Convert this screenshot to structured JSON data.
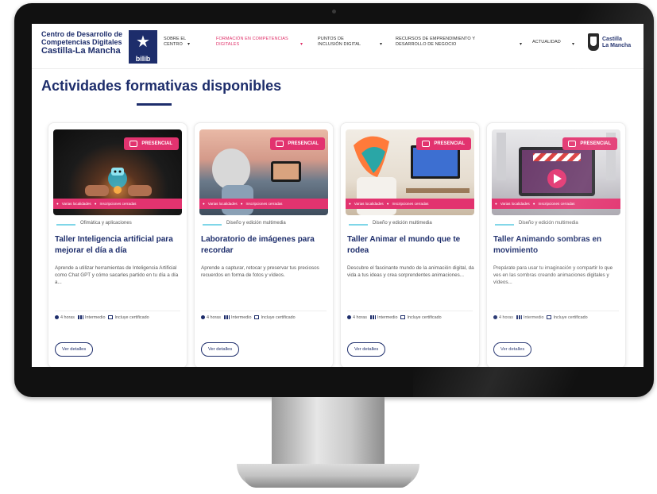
{
  "header": {
    "logo": {
      "line1": "Centro de Desarrollo de",
      "line2": "Competencias Digitales",
      "line3": "Castilla-La Mancha",
      "badge": "bilib"
    },
    "nav": [
      {
        "label": "SOBRE EL CENTRO",
        "active": false
      },
      {
        "label": "FORMACIÓN EN COMPETENCIAS DIGITALES",
        "active": true
      },
      {
        "label": "PUNTOS DE INCLUSIÓN DIGITAL",
        "active": false
      },
      {
        "label": "RECURSOS DE EMPRENDIMIENTO Y DESARROLLO DE NEGOCIO",
        "active": false
      },
      {
        "label": "ACTUALIDAD",
        "active": false
      }
    ],
    "region_logo": {
      "line1": "Castilla",
      "line2": "La Mancha"
    }
  },
  "section_title": "Actividades formativas disponibles",
  "cards": [
    {
      "badge": "PRESENCIAL",
      "locations": "Varias localidades",
      "status": "Inscripciones cerradas",
      "category": "Ofimática y aplicaciones",
      "title": "Taller Inteligencia artificial para mejorar el día a día",
      "description": "Aprende a utilizar herramientas de Inteligencia Artificial como Chat GPT y cómo sacarles partido en tu día a día a...",
      "duration": "4 horas",
      "level": "Intermedio",
      "certificate": "Incluye certificado",
      "button": "Ver detalles"
    },
    {
      "badge": "PRESENCIAL",
      "locations": "Varias localidades",
      "status": "Inscripciones cerradas",
      "category": "Diseño y edición multimedia",
      "title": "Laboratorio de imágenes para recordar",
      "description": "Aprende a capturar, retocar y preservar tus preciosos recuerdos en forma de fotos y vídeos.",
      "duration": "4 horas",
      "level": "Intermedio",
      "certificate": "Incluye certificado",
      "button": "Ver detalles"
    },
    {
      "badge": "PRESENCIAL",
      "locations": "Varias localidades",
      "status": "Inscripciones cerradas",
      "category": "Diseño y edición multimedia",
      "title": "Taller Animar el mundo que te rodea",
      "description": "Descubre el fascinante mundo de la animación digital, da vida a tus ideas y crea sorprendentes animaciones...",
      "duration": "4 horas",
      "level": "Intermedio",
      "certificate": "Incluye certificado",
      "button": "Ver detalles"
    },
    {
      "badge": "PRESENCIAL",
      "locations": "Varias localidades",
      "status": "Inscripciones cerradas",
      "category": "Diseño y edición multimedia",
      "title": "Taller Animando sombras en movimiento",
      "description": "Prepárate para usar tu imaginación y compartir lo que ves en las sombras creando animaciones digitales y vídeos...",
      "duration": "4 horas",
      "level": "Intermedio",
      "certificate": "Incluye certificado",
      "button": "Ver detalles"
    }
  ],
  "colors": {
    "brand": "#1d2d6b",
    "accent": "#e2336f",
    "category_line": "#7fd6e8"
  }
}
